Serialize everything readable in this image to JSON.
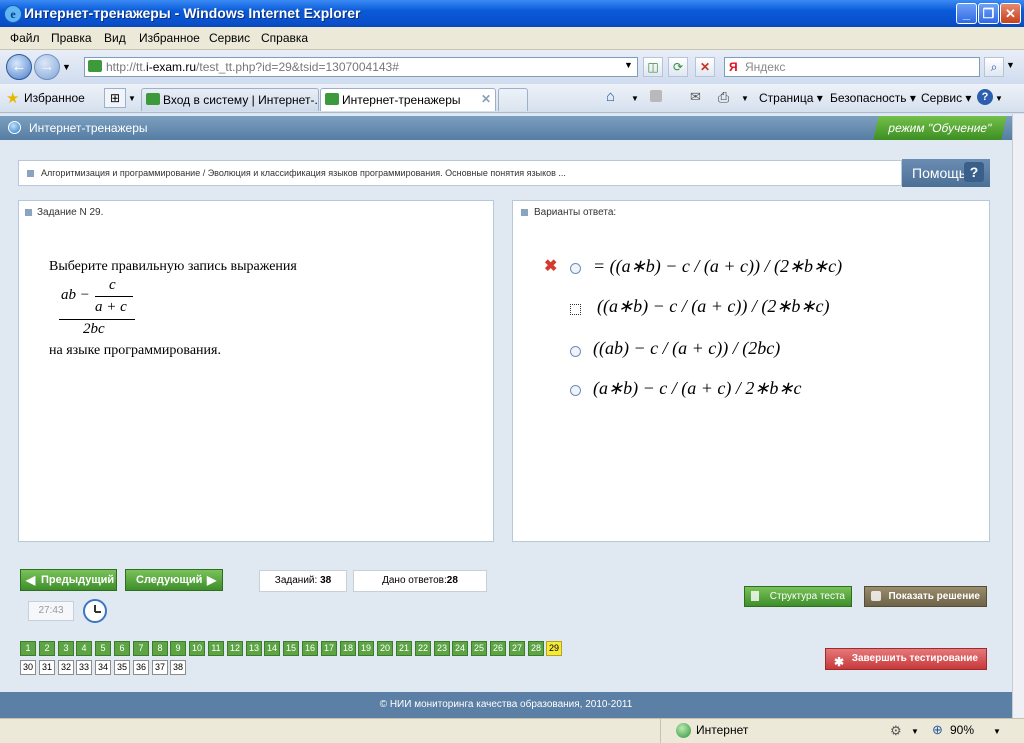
{
  "window": {
    "title": "Интернет-тренажеры - Windows Internet Explorer"
  },
  "menu": [
    "Файл",
    "Правка",
    "Вид",
    "Избранное",
    "Сервис",
    "Справка"
  ],
  "address": {
    "url_prefix": "http://tt.",
    "url_domain": "i-exam.ru",
    "url_path": "/test_tt.php?id=29&tsid=1307004143#",
    "search_placeholder": "Яндекс"
  },
  "favorites": {
    "label": "Избранное"
  },
  "tabs": [
    {
      "label": "Вход в систему | Интернет-..."
    },
    {
      "label": "Интернет-тренажеры"
    }
  ],
  "commands": {
    "page": "Страница",
    "security": "Безопасность",
    "service": "Сервис"
  },
  "page": {
    "header_title": "Интернет-тренажеры",
    "mode": "режим \"Обучение\"",
    "breadcrumb": "Алгоритмизация и программирование / Эволюция и классификация языков программирования. Основные понятия языков ...",
    "help": "Помощь",
    "help_mark": "?",
    "task": {
      "heading": "Задание N 29.",
      "text_before": "Выберите правильную запись выражения",
      "formula": {
        "top_left": "ab −",
        "inner_num": "c",
        "inner_den": "a + c",
        "denominator": "2bc"
      },
      "text_after": "на языке программирования."
    },
    "answers": {
      "heading": "Варианты ответа:",
      "options": [
        {
          "text": "= ((a∗b) − c / (a + c)) / (2∗b∗c)",
          "status": "wrong"
        },
        {
          "text": "((a∗b) − c / (a + c)) / (2∗b∗c)",
          "status": "focused"
        },
        {
          "text": "((ab) − c / (a + c)) / (2bc)",
          "status": ""
        },
        {
          "text": "(a∗b) − c / (a + c) / 2∗b∗c",
          "status": ""
        }
      ]
    },
    "nav": {
      "prev": "Предыдущий",
      "next": "Следующий"
    },
    "counters": {
      "tasks_label": "Заданий:",
      "tasks_value": "38",
      "answers_label": "Дано ответов:",
      "answers_value": "28"
    },
    "timer": "27:43",
    "buttons": {
      "structure": "Структура теста",
      "show_solution": "Показать решение",
      "finish": "Завершить тестирование"
    },
    "questions_done": [
      "1",
      "2",
      "3",
      "4",
      "5",
      "6",
      "7",
      "8",
      "9",
      "10",
      "11",
      "12",
      "13",
      "14",
      "15",
      "16",
      "17",
      "18",
      "19",
      "20",
      "21",
      "22",
      "23",
      "24",
      "25",
      "26",
      "27",
      "28"
    ],
    "question_current": "29",
    "questions_new": [
      "30",
      "31",
      "32",
      "33",
      "34",
      "35",
      "36",
      "37",
      "38"
    ],
    "footer": "© НИИ мониторинга качества образования, 2010-2011"
  },
  "status": {
    "zone": "Интернет",
    "zoom": "90%"
  },
  "colors": {
    "wrong": "#d33c2c",
    "done": "#5da445",
    "current": "#f5e93a",
    "finish": "#d9534f"
  }
}
